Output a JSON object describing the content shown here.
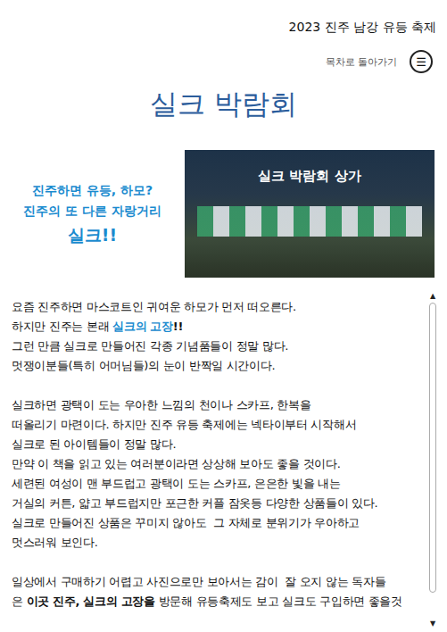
{
  "header": {
    "title": "2023 진주 남강 유등 축제"
  },
  "nav": {
    "back_label": "목차로 돌아가기",
    "menu_icon": "☰"
  },
  "page_title": "실크 박람회",
  "intro": {
    "lines": [
      "진주하면 유등, 하모?",
      "진주의 또 다른 자랑거리"
    ],
    "emphasis": "실크!!"
  },
  "photo": {
    "caption": "실크 박람회 상가"
  },
  "body": {
    "paragraphs": [
      [
        [
          {
            "text": "요즘 진주하면 마스코트인 귀여운 하모가 먼저 떠오른다.",
            "style": "plain"
          }
        ],
        [
          {
            "text": "하지만 진주는 본래 ",
            "style": "plain"
          },
          {
            "text": "실크의 고장",
            "style": "highlight"
          },
          {
            "text": "!!",
            "style": "bold"
          }
        ],
        [
          {
            "text": "그런 만큼 실크로 만들어진 각종 기념품들이 정말 많다.",
            "style": "plain"
          }
        ],
        [
          {
            "text": "멋쟁이분들(특히 어머님들)의 눈이 반짝일 시간이다.",
            "style": "plain"
          }
        ]
      ],
      [
        [
          {
            "text": "실크하면 광택이 도는 우아한 느낌의 천이나 스카프, 한복을",
            "style": "plain"
          }
        ],
        [
          {
            "text": "떠올리기 마련이다. 하지만 진주 유등 축제에는 넥타이부터 시작해서",
            "style": "plain"
          }
        ],
        [
          {
            "text": "실크로 된 아이템들이 정말 많다.",
            "style": "plain"
          }
        ],
        [
          {
            "text": "만약 이 책을 읽고 있는 여러분이라면 상상해 보아도 좋을 것이다.",
            "style": "plain"
          }
        ],
        [
          {
            "text": "세련된 여성이 맨 부드럽고 광택이 도는 스카프, 은은한 빛을 내는",
            "style": "plain"
          }
        ],
        [
          {
            "text": "거실의 커튼, 얇고 부드럽지만 포근한 커플 잠옷등 다양한 상품들이 있다.",
            "style": "plain"
          }
        ],
        [
          {
            "text": "실크로 만들어진 상품은 꾸미지 않아도  그 자체로 분위기가 우아하고",
            "style": "plain"
          }
        ],
        [
          {
            "text": "멋스러워 보인다.",
            "style": "plain"
          }
        ]
      ],
      [
        [
          {
            "text": "일상에서 구매하기 어렵고 사진으로만 보아서는 감이  잘 오지 않는 독자들",
            "style": "plain"
          }
        ],
        [
          {
            "text": "은 ",
            "style": "plain"
          },
          {
            "text": "이곳 진주, 실크의 고장을",
            "style": "bold"
          },
          {
            "text": " 방문해 유등축제도 보고 실크도 구입하면 좋을것",
            "style": "plain"
          }
        ]
      ]
    ]
  },
  "scrollbar": {
    "up": "▲",
    "down": "▼",
    "level": 0.92
  }
}
